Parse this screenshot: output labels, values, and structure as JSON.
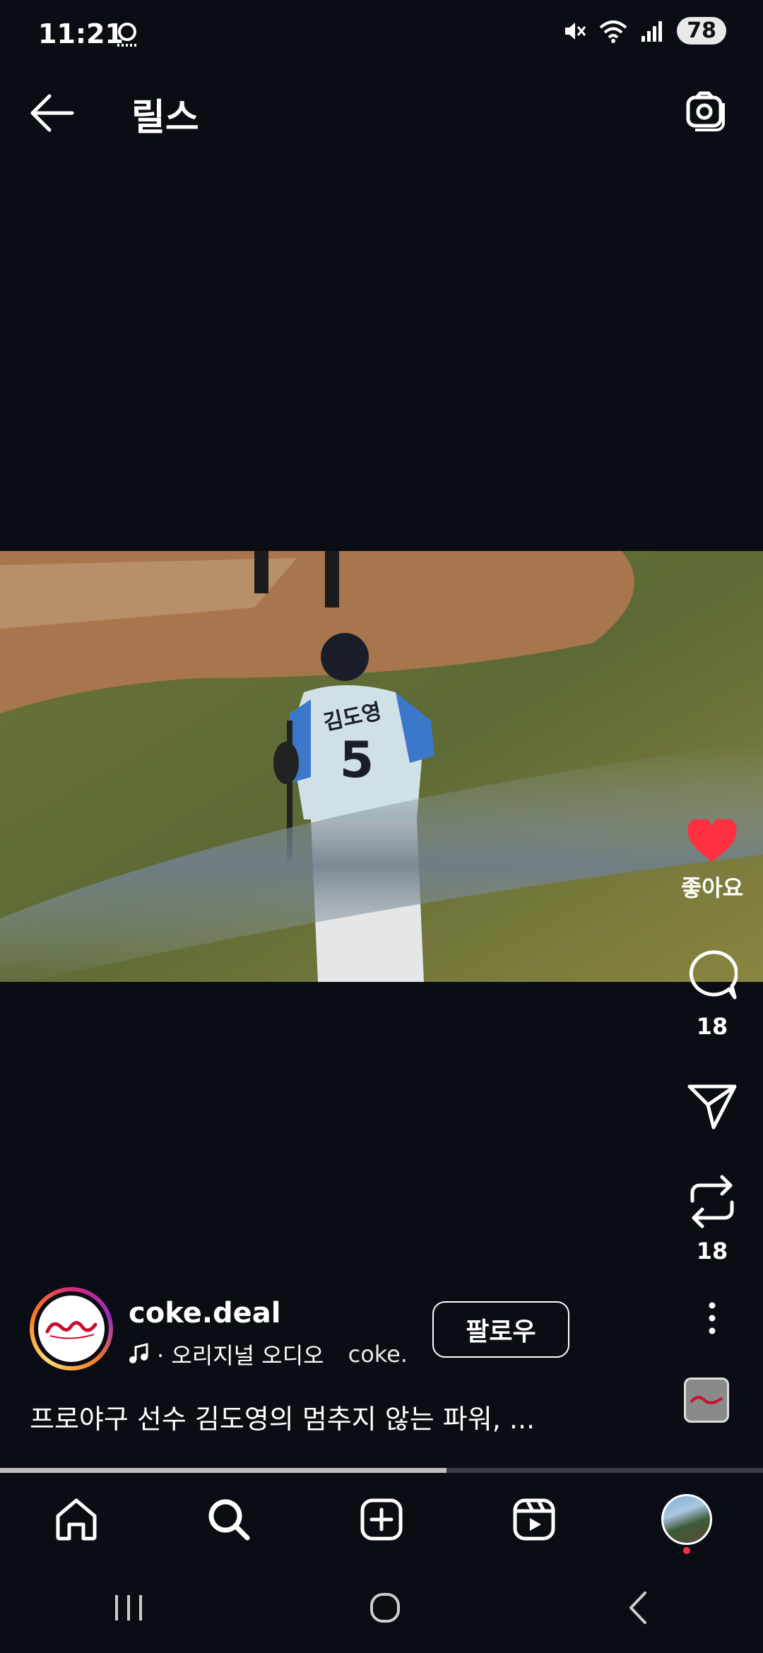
{
  "status": {
    "time": "11:21",
    "battery": "78"
  },
  "header": {
    "title": "릴스"
  },
  "reel": {
    "like_label": "좋아요",
    "comment_count": "18",
    "repost_count": "18",
    "username": "coke.deal",
    "audio_text": "· 오리지널 오디오",
    "audio_scroll_text": "coke.",
    "follow_label": "팔로우",
    "caption": "프로야구 선수 김도영의 멈추지 않는 파워, ...",
    "progress": 0.585,
    "jersey_name": "김도영",
    "jersey_number": "5"
  },
  "colors": {
    "like": "#ff3040",
    "background": "#0a0d14"
  },
  "icons": {
    "header": [
      "back-arrow-icon",
      "camera-icon"
    ],
    "rail": [
      "heart-icon",
      "comment-icon",
      "share-icon",
      "repost-icon",
      "more-icon"
    ],
    "nav": [
      "home-icon",
      "search-icon",
      "create-icon",
      "reels-icon",
      "profile-avatar"
    ]
  }
}
